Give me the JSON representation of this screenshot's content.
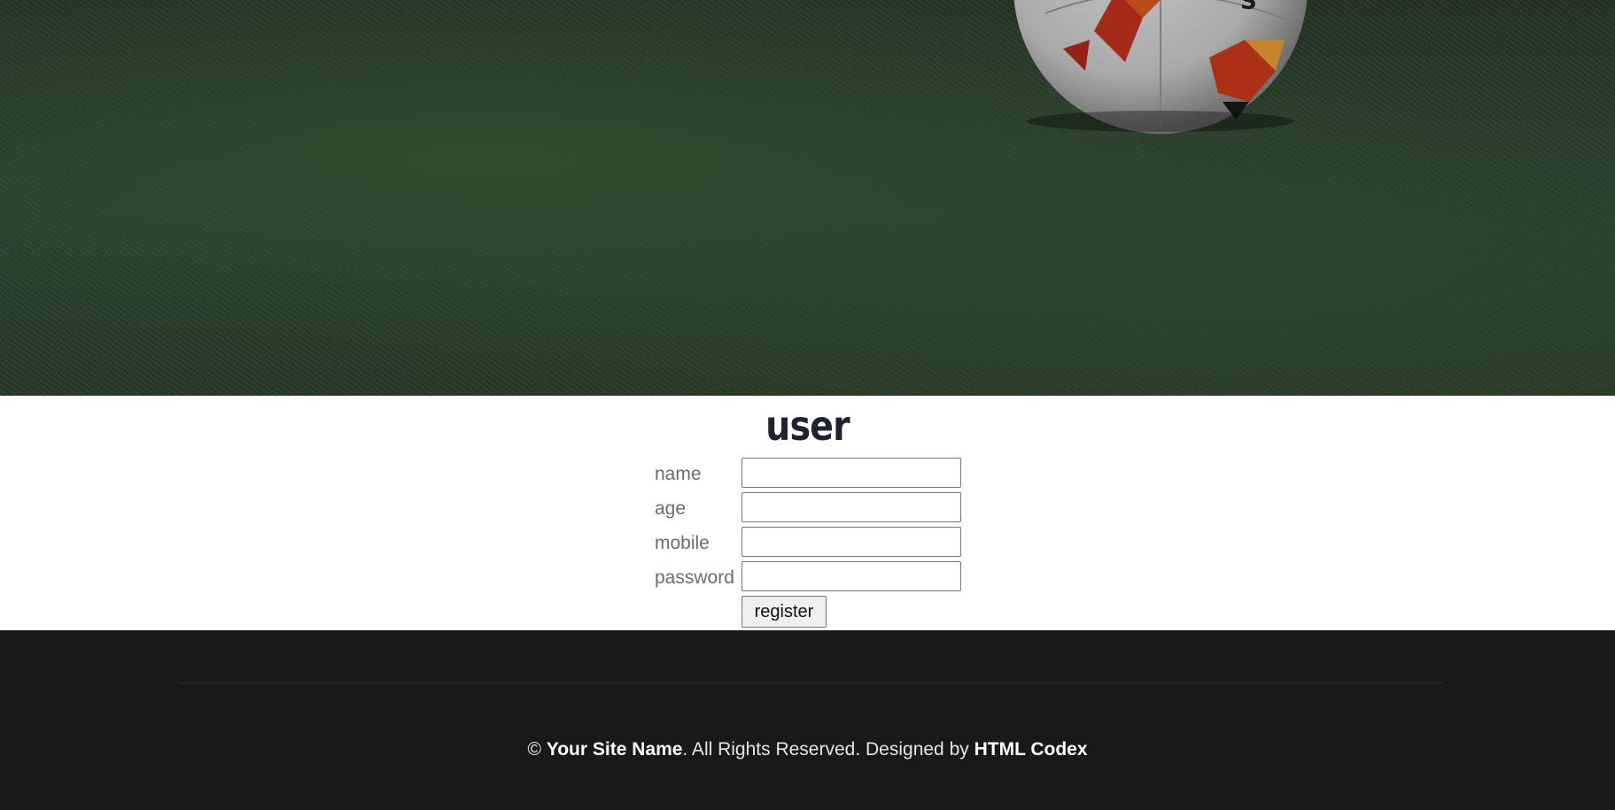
{
  "hero": {
    "image": "soccer-ball-on-grass",
    "overlay_color": "#000000"
  },
  "form": {
    "title": "user",
    "fields": [
      {
        "label": "name",
        "value": ""
      },
      {
        "label": "age",
        "value": ""
      },
      {
        "label": "mobile",
        "value": ""
      },
      {
        "label": "password",
        "value": ""
      }
    ],
    "submit_label": "register"
  },
  "footer": {
    "copyright_symbol": "©",
    "site_name": "Your Site Name",
    "rights_text": ". All Rights Reserved. Designed by ",
    "designer": "HTML Codex",
    "background": "#191919"
  }
}
